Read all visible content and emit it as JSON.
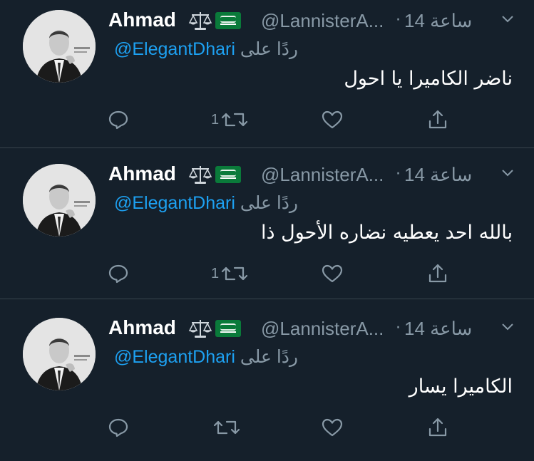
{
  "tweets": [
    {
      "name": "Ahmad",
      "handle": "@LannisterA...",
      "dot": "·",
      "time": "14 ساعة",
      "reply_prefix": "ردًا على",
      "reply_to": "@ElegantDhari",
      "text": "ناضر الكاميرا يا احول",
      "retweets": "1"
    },
    {
      "name": "Ahmad",
      "handle": "@LannisterA...",
      "dot": "·",
      "time": "14 ساعة",
      "reply_prefix": "ردًا على",
      "reply_to": "@ElegantDhari",
      "text": "بالله احد يعطيه نضاره الأحول ذا",
      "retweets": "1"
    },
    {
      "name": "Ahmad",
      "handle": "@LannisterA...",
      "dot": "·",
      "time": "14 ساعة",
      "reply_prefix": "ردًا على",
      "reply_to": "@ElegantDhari",
      "text": "الكاميرا يسار",
      "retweets": ""
    }
  ],
  "icons": {
    "emoji": [
      "balance-scale-icon",
      "saudi-flag-icon"
    ],
    "actions": [
      "reply-icon",
      "retweet-icon",
      "like-icon",
      "share-icon"
    ],
    "menu": "chevron-down-icon"
  },
  "colors": {
    "background": "#15202b",
    "secondary_text": "#8899a6",
    "link": "#1da1f2",
    "divider": "#38444d"
  }
}
